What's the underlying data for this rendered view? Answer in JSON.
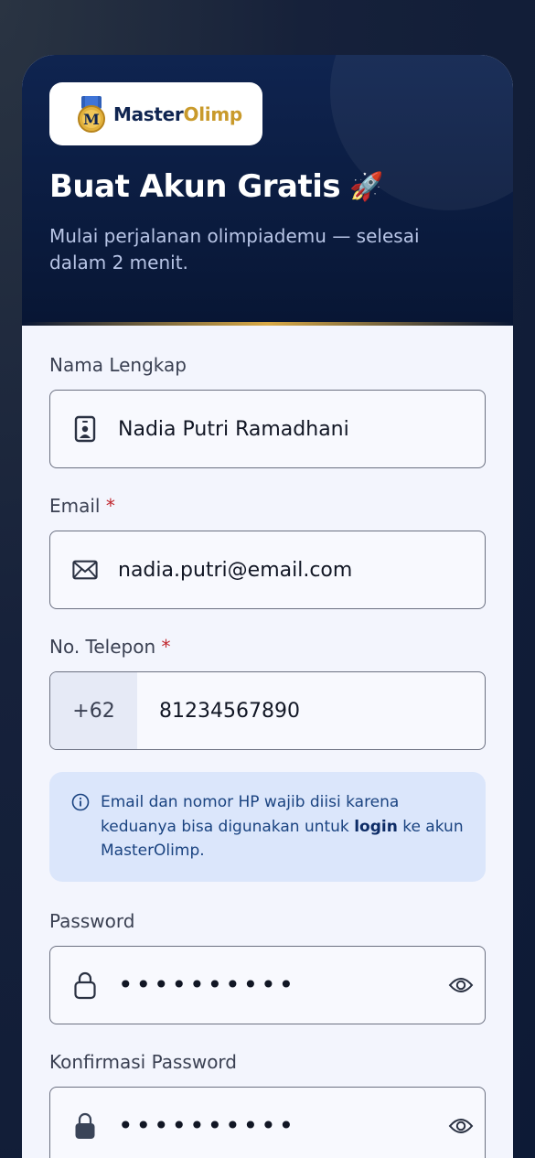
{
  "brand": {
    "name_part1": "Master",
    "name_part2": "Olimp",
    "colors": {
      "navy": "#0f2450",
      "gold": "#c99a2b"
    }
  },
  "header": {
    "title": "Buat Akun Gratis",
    "title_emoji": "🚀",
    "subtitle": "Mulai perjalanan olimpiademu — selesai dalam 2 menit."
  },
  "form": {
    "full_name": {
      "label": "Nama Lengkap",
      "value": "Nadia Putri Ramadhani",
      "icon": "id-card-icon"
    },
    "email": {
      "label": "Email",
      "required_mark": "*",
      "value": "nadia.putri@email.com",
      "icon": "envelope-icon"
    },
    "phone": {
      "label": "No. Telepon",
      "required_mark": "*",
      "prefix": "+62",
      "value": "81234567890"
    },
    "info": {
      "icon": "info-icon",
      "text_before": "Email dan nomor HP wajib diisi karena keduanya bisa digunakan untuk ",
      "text_bold": "login",
      "text_after": " ke akun MasterOlimp."
    },
    "password": {
      "label": "Password",
      "value": "••••••••••",
      "icon": "lock-open-icon"
    },
    "confirm_password": {
      "label": "Konfirmasi Password",
      "value": "••••••••••",
      "icon": "lock-icon"
    }
  }
}
